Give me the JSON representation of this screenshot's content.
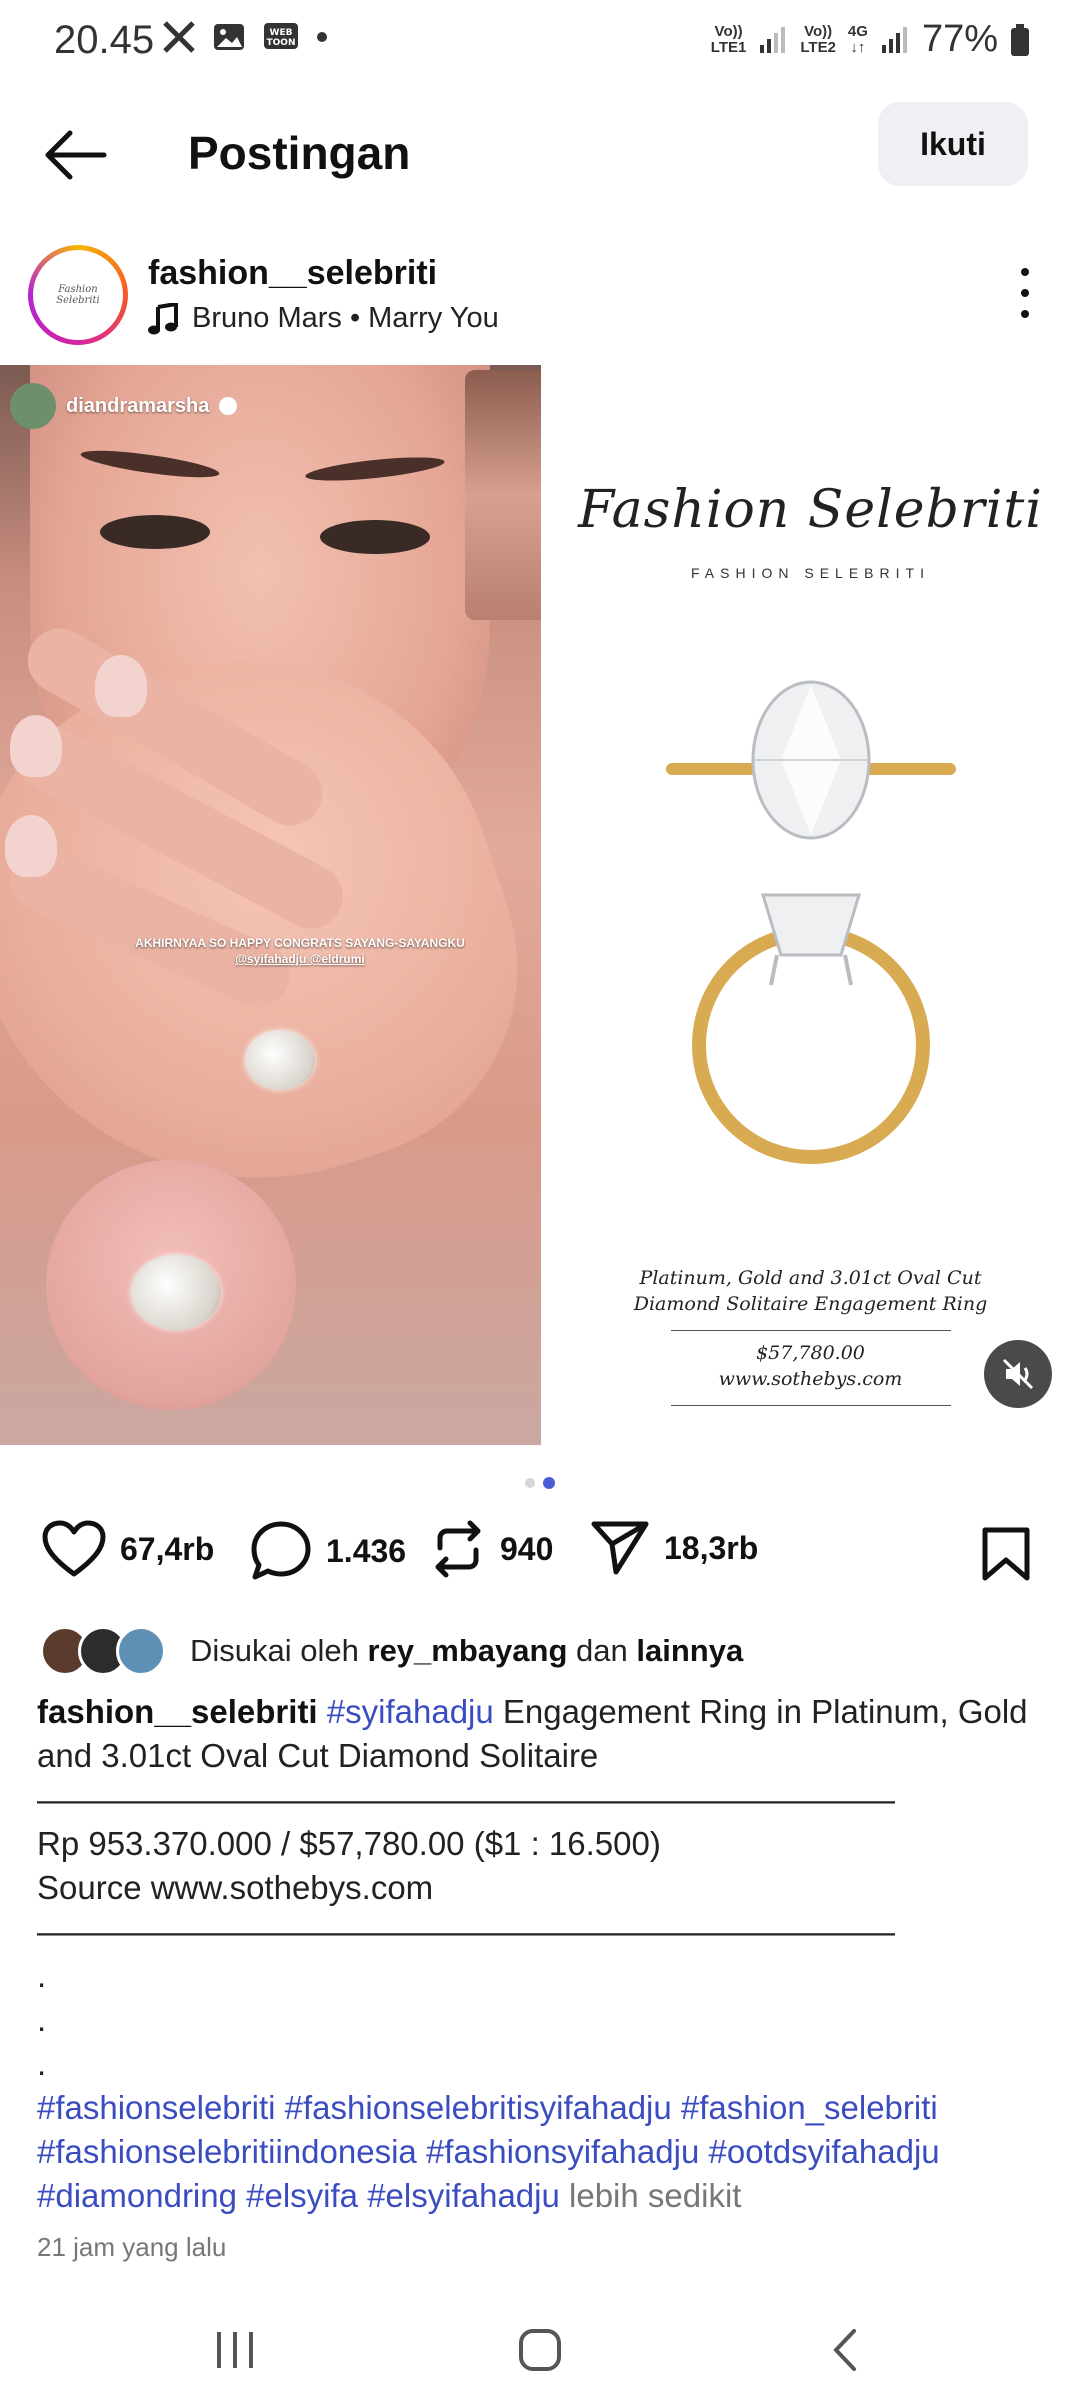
{
  "status_bar": {
    "time": "20.45",
    "sim1_top": "Vo))",
    "sim1_bottom": "LTE1",
    "sim2_top": "Vo))",
    "sim2_bottom": "LTE2",
    "network": "4G",
    "battery": "77%"
  },
  "header": {
    "title": "Postingan",
    "follow_label": "Ikuti"
  },
  "author": {
    "username": "fashion__selebriti",
    "avatar_text": "Fashion Selebriti",
    "music": "Bruno Mars • Marry You"
  },
  "media": {
    "story_username": "diandramarsha",
    "story_caption_line1": "AKHIRNYAA SO HAPPY CONGRATS SAYANG-SAYANGKU",
    "story_caption_line2": "@syifahadju @eldrumi",
    "brand_script": "Fashion Selebriti",
    "brand_caps": "FASHION SELEBRITI",
    "ring_caption_line1": "Platinum, Gold and 3.01ct Oval Cut",
    "ring_caption_line2": "Diamond Solitaire Engagement Ring",
    "price_line": "$57,780.00",
    "source_line": "www.sothebys.com",
    "active_slide": 2,
    "slide_count": 2
  },
  "actions": {
    "likes": "67,4rb",
    "comments": "1.436",
    "reposts": "940",
    "shares": "18,3rb"
  },
  "liked_by": {
    "prefix": "Disukai oleh",
    "user": "rey_mbayang",
    "connector": "dan",
    "others": "lainnya"
  },
  "caption": {
    "username": "fashion__selebriti",
    "hashtag_first": "#syifahadju",
    "text1": " Engagement Ring in Platinum, Gold and 3.01ct Oval Cut Diamond Solitaire",
    "divider": "——————————————————————————",
    "price_line": "Rp 953.370.000 / $57,780.00 ($1 : 16.500)",
    "source_line": "Source www.sothebys.com",
    "dot": ".",
    "hashtags": [
      "#fashionselebriti",
      "#fashionselebritisyifahadju",
      "#fashion_selebriti",
      "#fashionselebritiindonesia",
      "#fashionsyifahadju",
      "#ootdsyifahadju",
      "#diamondring",
      "#elsyifa",
      "#elsyifahadju"
    ],
    "more_label": "lebih sedikit"
  },
  "timestamp": "21 jam yang lalu",
  "colors": {
    "hashtag": "#3b4cc0",
    "pager_active": "#4a5bd6",
    "follow_bg": "#eef0f3"
  }
}
